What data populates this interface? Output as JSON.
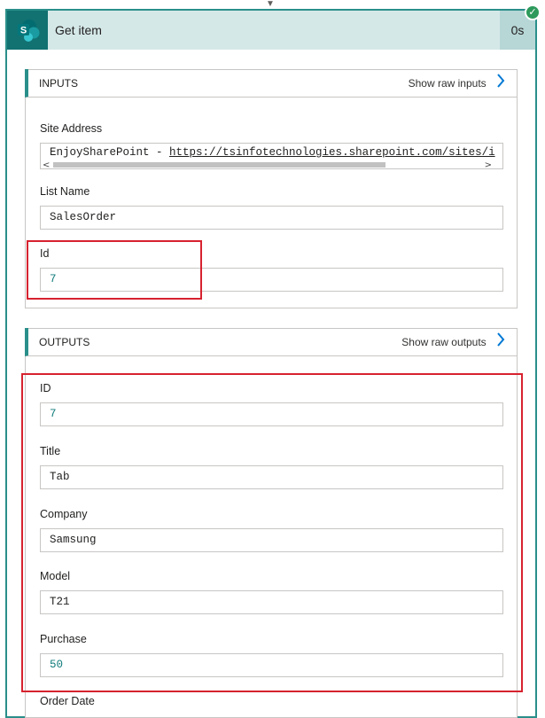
{
  "header": {
    "title": "Get item",
    "duration": "0s",
    "icon": "sharepoint-icon",
    "status_icon": "success-check-icon",
    "accent_color": "#127171"
  },
  "inputs": {
    "title": "INPUTS",
    "raw_link": "Show raw inputs",
    "fields": {
      "site_address": {
        "label": "Site Address",
        "value_prefix": "EnjoySharePoint - ",
        "value_link": "https://tsinfotechnologies.sharepoint.com/sites/i"
      },
      "list_name": {
        "label": "List Name",
        "value": "SalesOrder"
      },
      "id": {
        "label": "Id",
        "value": "7"
      }
    }
  },
  "outputs": {
    "title": "OUTPUTS",
    "raw_link": "Show raw outputs",
    "fields": {
      "id": {
        "label": "ID",
        "value": "7"
      },
      "title": {
        "label": "Title",
        "value": "Tab"
      },
      "company": {
        "label": "Company",
        "value": "Samsung"
      },
      "model": {
        "label": "Model",
        "value": "T21"
      },
      "purchase": {
        "label": "Purchase",
        "value": "50"
      },
      "order_date": {
        "label": "Order Date"
      }
    }
  },
  "highlight_color": "#d7222f"
}
